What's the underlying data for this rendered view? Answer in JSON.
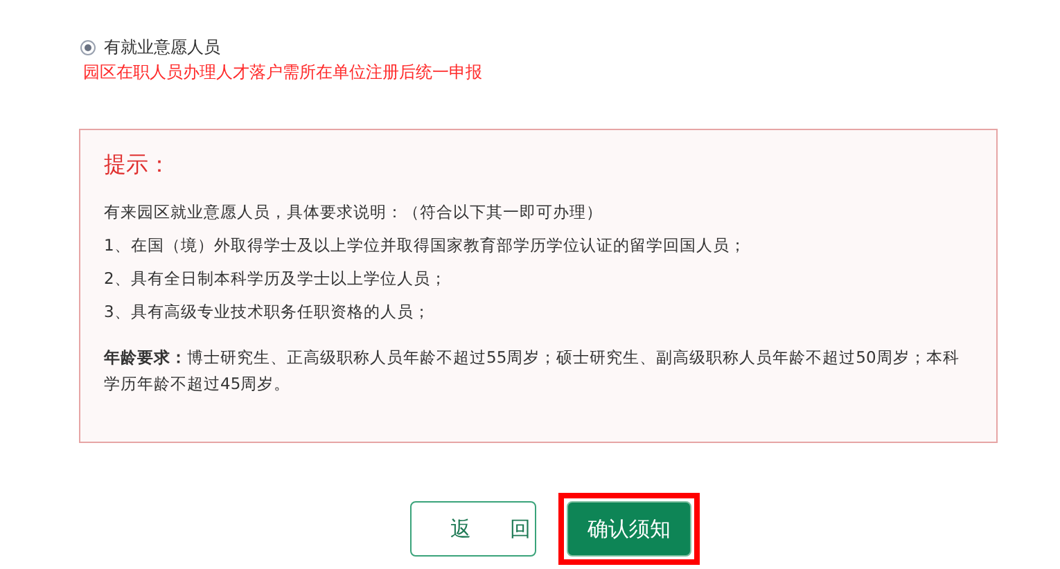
{
  "option": {
    "label": "有就业意愿人员",
    "selected": true
  },
  "notice": "园区在职人员办理人才落户需所在单位注册后统一申报",
  "tip": {
    "title": "提示：",
    "lines": [
      "有来园区就业意愿人员，具体要求说明：（符合以下其一即可办理）",
      "1、在国（境）外取得学士及以上学位并取得国家教育部学历学位认证的留学回国人员；",
      "2、具有全日制本科学历及学士以上学位人员；",
      "3、具有高级专业技术职务任职资格的人员；"
    ],
    "age": "**年龄要求：**博士研究生、正高级职称人员年龄不超过55周岁；硕士研究生、副高级职称人员年龄不超过50周岁；本科学历年龄不超过45周岁。"
  },
  "buttons": [
    {
      "label": "返回",
      "kind": "outline",
      "highlighted": false
    },
    {
      "label": "确认须知",
      "kind": "primary",
      "highlighted": true
    }
  ]
}
